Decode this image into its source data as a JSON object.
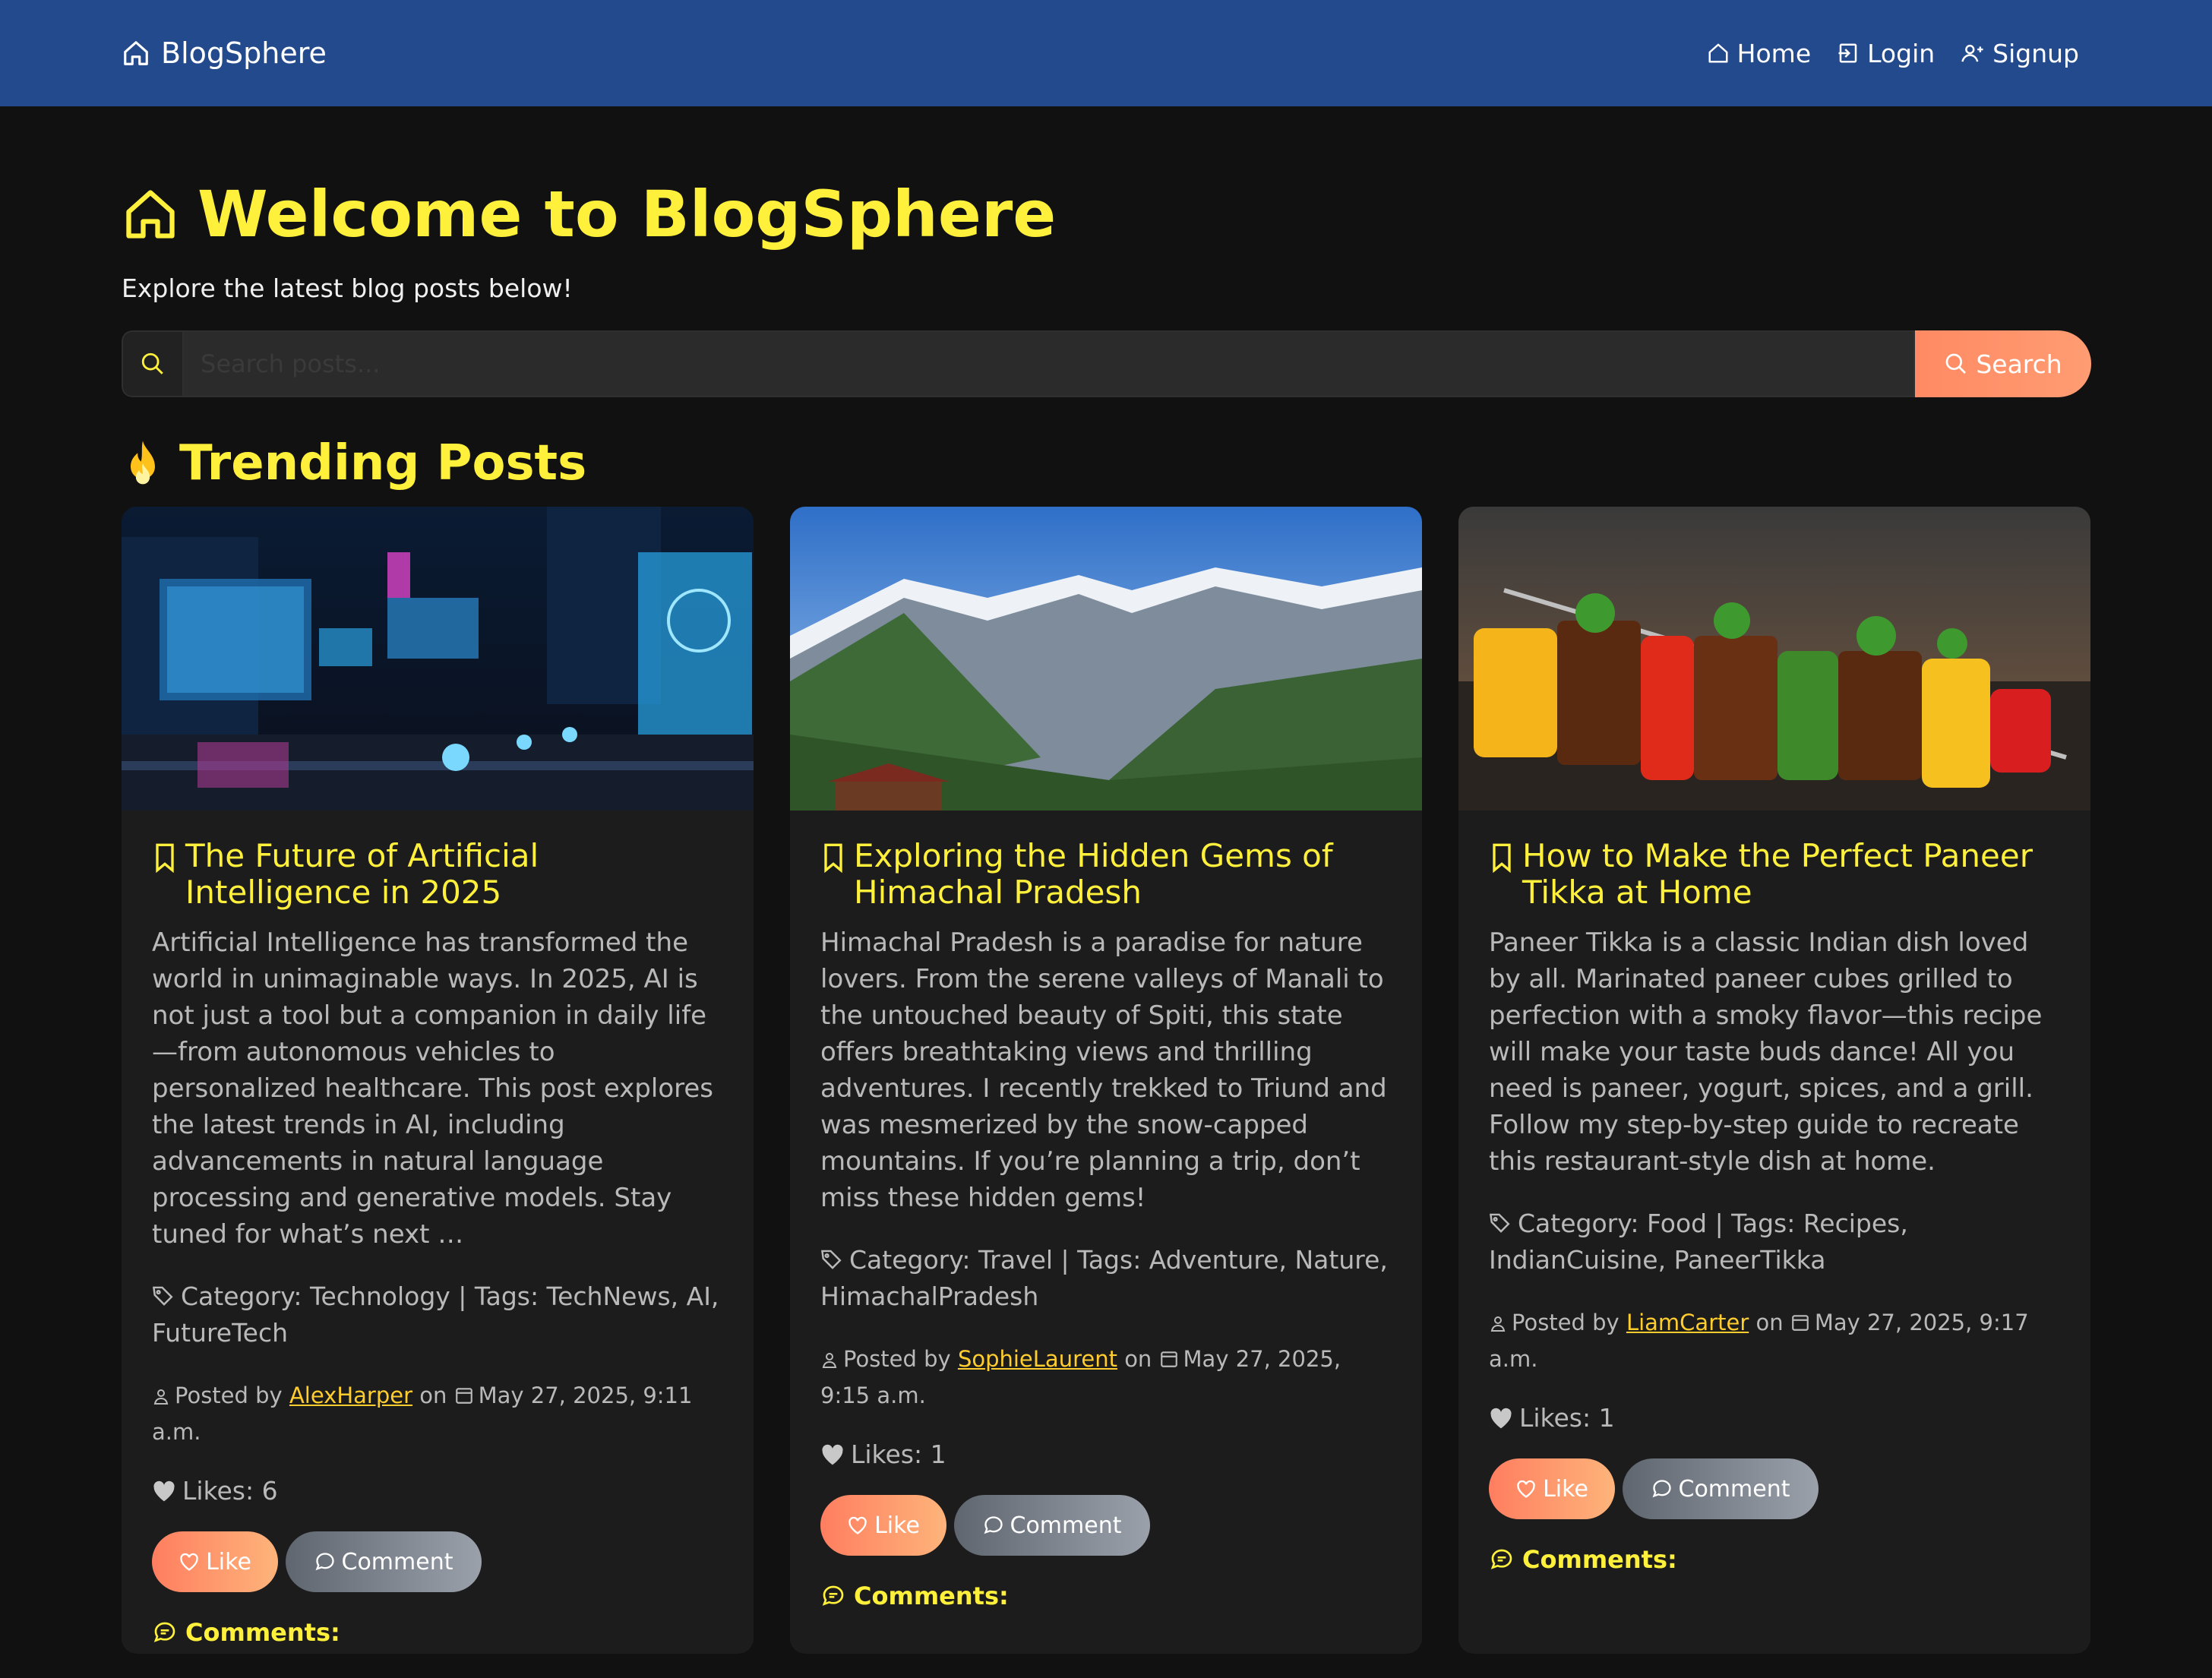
{
  "nav": {
    "brand": "BlogSphere",
    "links": [
      {
        "label": "Home",
        "icon": "home-icon"
      },
      {
        "label": "Login",
        "icon": "login-icon"
      },
      {
        "label": "Signup",
        "icon": "user-plus-icon"
      }
    ]
  },
  "hero": {
    "title": "Welcome to BlogSphere",
    "subtitle": "Explore the latest blog posts below!"
  },
  "search": {
    "placeholder": "Search posts...",
    "button_label": "Search"
  },
  "trending": {
    "title": "Trending Posts"
  },
  "posts": [
    {
      "title": "The Future of Artificial Intelligence in 2025",
      "excerpt": "Artificial Intelligence has transformed the world in unimaginable ways. In 2025, AI is not just a tool but a companion in daily life—from autonomous vehicles to personalized healthcare. This post explores the latest trends in AI, including advancements in natural language processing and generative models. Stay tuned for what’s next …",
      "meta": "Category: Technology | Tags: TechNews, AI, FutureTech",
      "posted_prefix": "Posted by",
      "author": "AlexHarper",
      "on": "on",
      "date": "May 27, 2025, 9:11 a.m.",
      "likes": "Likes: 6",
      "like_label": "Like",
      "comment_label": "Comment",
      "comments_heading": "Comments:"
    },
    {
      "title": "Exploring the Hidden Gems of Himachal Pradesh",
      "excerpt": "Himachal Pradesh is a paradise for nature lovers. From the serene valleys of Manali to the untouched beauty of Spiti, this state offers breathtaking views and thrilling adventures. I recently trekked to Triund and was mesmerized by the snow-capped mountains. If you’re planning a trip, don’t miss these hidden gems!",
      "meta": "Category: Travel | Tags: Adventure, Nature, HimachalPradesh",
      "posted_prefix": "Posted by",
      "author": "SophieLaurent",
      "on": "on",
      "date": "May 27, 2025, 9:15 a.m.",
      "likes": "Likes: 1",
      "like_label": "Like",
      "comment_label": "Comment",
      "comments_heading": "Comments:"
    },
    {
      "title": "How to Make the Perfect Paneer Tikka at Home",
      "excerpt": "Paneer Tikka is a classic Indian dish loved by all. Marinated paneer cubes grilled to perfection with a smoky flavor—this recipe will make your taste buds dance! All you need is paneer, yogurt, spices, and a grill. Follow my step-by-step guide to recreate this restaurant-style dish at home.",
      "meta": "Category: Food | Tags: Recipes, IndianCuisine, PaneerTikka",
      "posted_prefix": "Posted by",
      "author": "LiamCarter",
      "on": "on",
      "date": "May 27, 2025, 9:17 a.m.",
      "likes": "Likes: 1",
      "like_label": "Like",
      "comment_label": "Comment",
      "comments_heading": "Comments:"
    }
  ]
}
